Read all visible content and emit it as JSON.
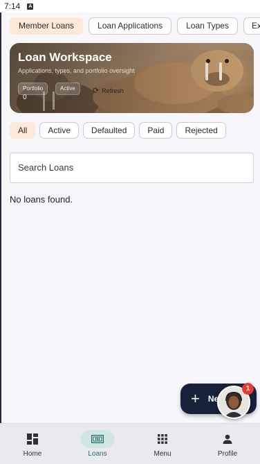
{
  "status_bar": {
    "time": "7:14",
    "sim_glyph": "A"
  },
  "top_tabs": [
    {
      "label": "Member Loans",
      "selected": true
    },
    {
      "label": "Loan Applications",
      "selected": false
    },
    {
      "label": "Loan Types",
      "selected": false
    },
    {
      "label": "Exten",
      "selected": false
    }
  ],
  "hero": {
    "title": "Loan Workspace",
    "subtitle": "Applications, types, and portfolio oversight",
    "chips": [
      "Portfolio",
      "Active"
    ],
    "chip_value": "0",
    "refresh_label": "Refresh",
    "refresh_icon": "refresh-icon"
  },
  "filters": [
    {
      "label": "All",
      "selected": true
    },
    {
      "label": "Active",
      "selected": false
    },
    {
      "label": "Defaulted",
      "selected": false
    },
    {
      "label": "Paid",
      "selected": false
    },
    {
      "label": "Rejected",
      "selected": false
    }
  ],
  "search": {
    "placeholder": "Search Loans"
  },
  "empty_message": "No loans found.",
  "fab": {
    "label": "Ne",
    "icon": "plus-icon"
  },
  "notification_badge": "1",
  "bottom_nav": [
    {
      "label": "Home",
      "icon": "dashboard-icon",
      "active": false
    },
    {
      "label": "Loans",
      "icon": "money-icon",
      "active": true
    },
    {
      "label": "Menu",
      "icon": "grid-icon",
      "active": false
    },
    {
      "label": "Profile",
      "icon": "person-icon",
      "active": false
    }
  ],
  "colors": {
    "accent_selected": "#fde9d6",
    "nav_active_pill": "#cfe6e2",
    "nav_active_text": "#1e6b68",
    "fab_bg": "#16213a",
    "badge": "#e53935"
  }
}
